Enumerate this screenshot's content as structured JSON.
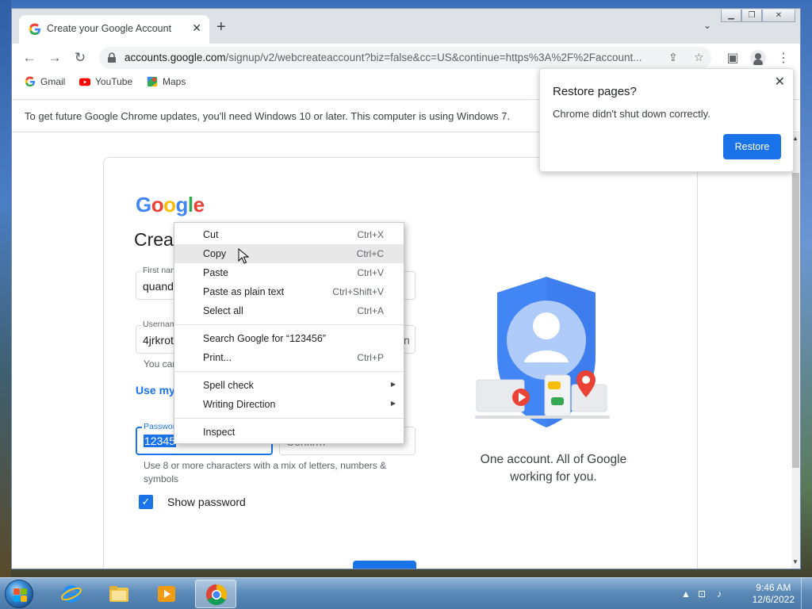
{
  "browser": {
    "tab_title": "Create your Google Account",
    "url_host": "accounts.google.com",
    "url_rest": "/signup/v2/webcreateaccount?biz=false&cc=US&continue=https%3A%2F%2Faccount...",
    "bookmarks": [
      {
        "label": "Gmail",
        "icon": "google-icon"
      },
      {
        "label": "YouTube",
        "icon": "youtube-icon"
      },
      {
        "label": "Maps",
        "icon": "maps-icon"
      }
    ],
    "infobar_text": "To get future Google Chrome updates, you'll need Windows 10 or later. This computer is using Windows 7."
  },
  "restore_popup": {
    "title": "Restore pages?",
    "body": "Chrome didn't shut down correctly.",
    "button": "Restore"
  },
  "form": {
    "logo": "Google",
    "heading_visible": "Crea",
    "first_name_label": "First nam",
    "first_name_value": "quand",
    "username_label": "Usernam",
    "username_value": "4jrkrot",
    "username_suffix": "n",
    "username_hint": "You can",
    "use_link": "Use my",
    "password_label": "Passwor",
    "password_value": "12345",
    "confirm_value": "Confirm",
    "password_hint": "Use 8 or more characters with a mix of letters, numbers & symbols",
    "show_password": "Show password",
    "tagline": "One account. All of Google working for you."
  },
  "context_menu": {
    "groups": [
      [
        {
          "label": "Cut",
          "shortcut": "Ctrl+X"
        },
        {
          "label": "Copy",
          "shortcut": "Ctrl+C",
          "highlighted": true
        },
        {
          "label": "Paste",
          "shortcut": "Ctrl+V"
        },
        {
          "label": "Paste as plain text",
          "shortcut": "Ctrl+Shift+V"
        },
        {
          "label": "Select all",
          "shortcut": "Ctrl+A"
        }
      ],
      [
        {
          "label": "Search Google for “123456”",
          "shortcut": ""
        },
        {
          "label": "Print...",
          "shortcut": "Ctrl+P"
        }
      ],
      [
        {
          "label": "Spell check",
          "shortcut": "",
          "submenu": true
        },
        {
          "label": "Writing Direction",
          "shortcut": "",
          "submenu": true
        }
      ],
      [
        {
          "label": "Inspect",
          "shortcut": ""
        }
      ]
    ]
  },
  "taskbar": {
    "time": "9:46 AM",
    "date": "12/6/2022"
  },
  "colors": {
    "accent": "#1a73e8"
  }
}
